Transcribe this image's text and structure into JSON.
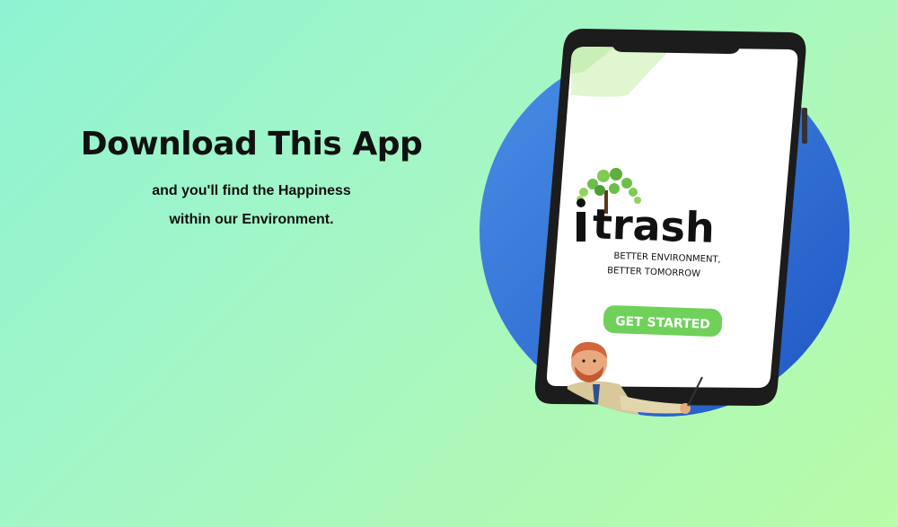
{
  "hero": {
    "title": "Download This App",
    "subtitle_line1": "and you'll find the Happiness",
    "subtitle_line2": "within our Environment."
  },
  "app_screen": {
    "brand_text": "trash",
    "tagline_line1": "BETTER ENVIRONMENT,",
    "tagline_line2": "BETTER TOMORROW",
    "get_started_label": "GET STARTED"
  },
  "colors": {
    "background_start": "#8ef3d2",
    "background_end": "#b8fba8",
    "circle_blue": "#2e6fd8",
    "button_green": "#6fd15a",
    "phone_frame": "#1c1c1c",
    "tree_green": "#6cc04a"
  }
}
